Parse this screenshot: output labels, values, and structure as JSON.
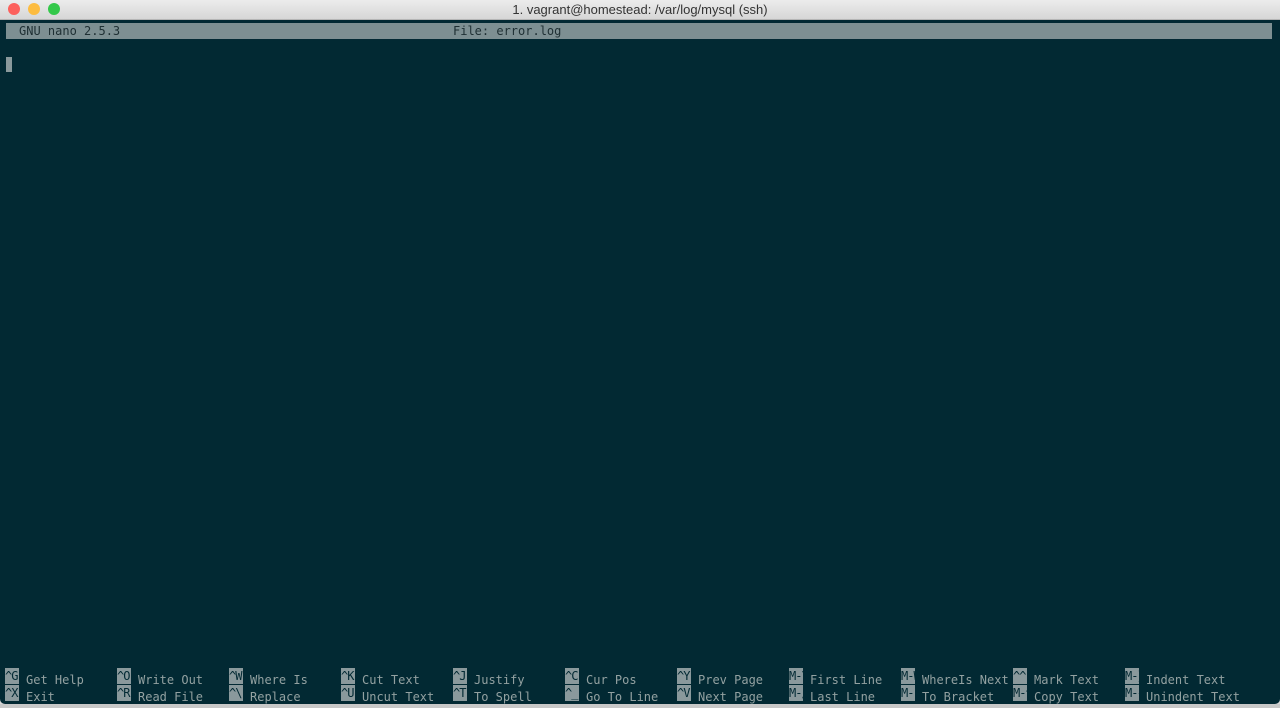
{
  "window": {
    "title": "1. vagrant@homestead: /var/log/mysql (ssh)"
  },
  "nano": {
    "version": "GNU nano 2.5.3",
    "file": "File: error.log"
  },
  "shortcuts": [
    [
      {
        "key": "^G",
        "label": "Get Help"
      },
      {
        "key": "^X",
        "label": "Exit"
      }
    ],
    [
      {
        "key": "^O",
        "label": "Write Out"
      },
      {
        "key": "^R",
        "label": "Read File"
      }
    ],
    [
      {
        "key": "^W",
        "label": "Where Is"
      },
      {
        "key": "^\\",
        "label": "Replace"
      }
    ],
    [
      {
        "key": "^K",
        "label": "Cut Text"
      },
      {
        "key": "^U",
        "label": "Uncut Text"
      }
    ],
    [
      {
        "key": "^J",
        "label": "Justify"
      },
      {
        "key": "^T",
        "label": "To Spell"
      }
    ],
    [
      {
        "key": "^C",
        "label": "Cur Pos"
      },
      {
        "key": "^_",
        "label": "Go To Line"
      }
    ],
    [
      {
        "key": "^Y",
        "label": "Prev Page"
      },
      {
        "key": "^V",
        "label": "Next Page"
      }
    ],
    [
      {
        "key": "M-\\",
        "label": "First Line"
      },
      {
        "key": "M-/",
        "label": "Last Line"
      }
    ],
    [
      {
        "key": "M-W",
        "label": "WhereIs Next"
      },
      {
        "key": "M-]",
        "label": "To Bracket"
      }
    ],
    [
      {
        "key": "^^",
        "label": "Mark Text"
      },
      {
        "key": "M-^",
        "label": "Copy Text"
      }
    ],
    [
      {
        "key": "M-}",
        "label": "Indent Text"
      },
      {
        "key": "M-{",
        "label": "Unindent Text"
      }
    ]
  ]
}
